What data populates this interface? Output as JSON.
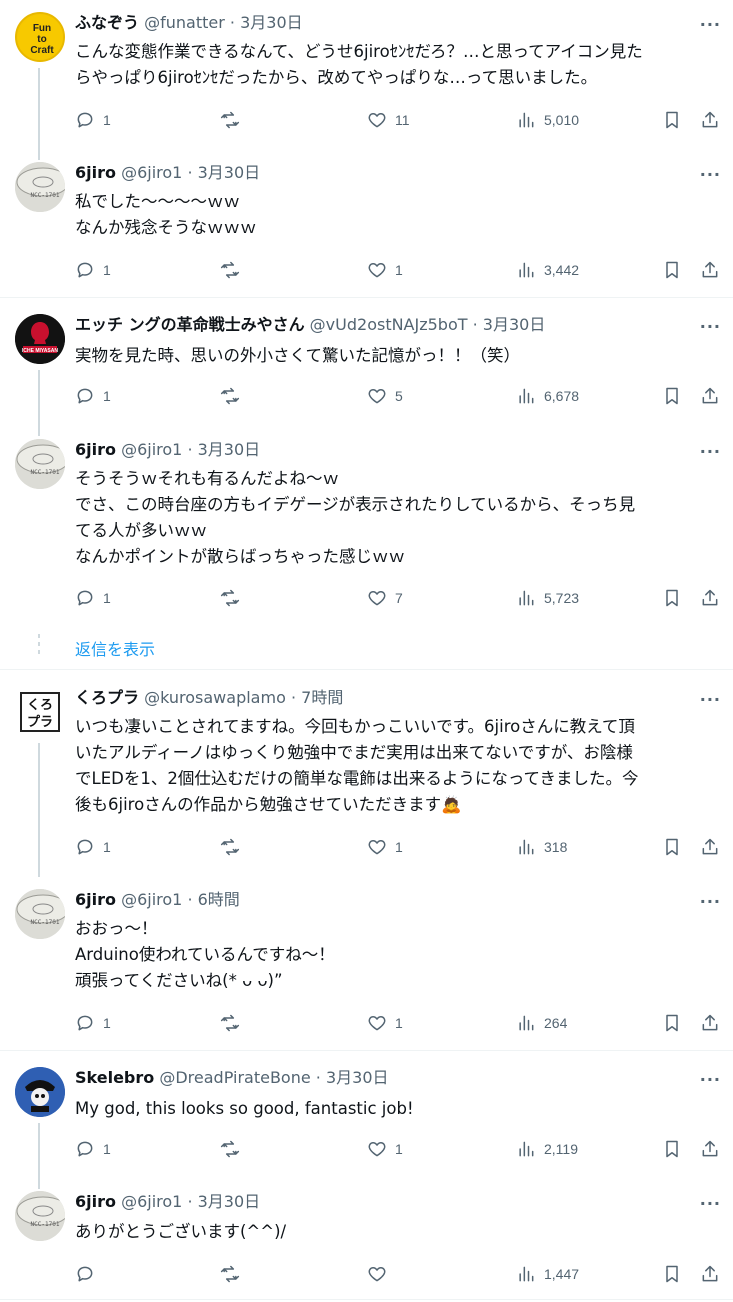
{
  "tweets": [
    {
      "name": "ふなぞう",
      "handle": "@funatter",
      "date": "3月30日",
      "lines": [
        "こんな変態作業できるなんて、どうせ6jiroｾﾝｾだろ？…と思ってアイコン見た",
        "らやっぱり6jiroｾﾝｾだったから、改めてやっぱりな…って思いました。"
      ],
      "replies": "1",
      "retweets": "",
      "likes": "11",
      "views": "5,010",
      "avatar": "fun-to-craft"
    },
    {
      "name": "6jiro",
      "handle": "@6jiro1",
      "date": "3月30日",
      "lines": [
        "私でした～～～～ｗｗ",
        "なんか残念そうなｗｗｗ"
      ],
      "replies": "1",
      "retweets": "",
      "likes": "1",
      "views": "3,442",
      "avatar": "6jiro"
    },
    {
      "name": "エッチ ングの革命戦士みやさん",
      "handle": "@vUd2ostNAJz5boT",
      "date": "3月30日",
      "lines": [
        "実物を見た時、思いの外小さくて驚いた記憶がっ！！（笑）"
      ],
      "replies": "1",
      "retweets": "",
      "likes": "5",
      "views": "6,678",
      "avatar": "miyasan"
    },
    {
      "name": "6jiro",
      "handle": "@6jiro1",
      "date": "3月30日",
      "lines": [
        "そうそうｗそれも有るんだよね～ｗ",
        "でさ、この時台座の方もイデゲージが表示されたりしているから、そっち見",
        "てる人が多いｗｗ",
        "なんかポイントが散らばっちゃった感じｗｗ"
      ],
      "replies": "1",
      "retweets": "",
      "likes": "7",
      "views": "5,723",
      "avatar": "6jiro"
    },
    {
      "name": "くろプラ",
      "handle": "@kurosawaplamo",
      "date": "7時間",
      "lines": [
        "いつも凄いことされてますね。今回もかっこいいです。6jiroさんに教えて頂",
        "いたアルディーノはゆっくり勉強中でまだ実用は出来てないですが、お陰様",
        "でLEDを1、2個仕込むだけの簡単な電飾は出来るようになってきました。今",
        "後も6jiroさんの作品から勉強させていただきます🙇"
      ],
      "replies": "1",
      "retweets": "",
      "likes": "1",
      "views": "318",
      "avatar": "kuropura"
    },
    {
      "name": "6jiro",
      "handle": "@6jiro1",
      "date": "6時間",
      "lines": [
        "おおっ～！",
        "Arduino使われているんですね～！",
        "頑張ってくださいね(* ᴗ ᴗ)”"
      ],
      "replies": "1",
      "retweets": "",
      "likes": "1",
      "views": "264",
      "avatar": "6jiro"
    },
    {
      "name": "Skelebro",
      "handle": "@DreadPirateBone",
      "date": "3月30日",
      "lines": [
        "My god, this looks so good, fantastic job!"
      ],
      "replies": "1",
      "retweets": "",
      "likes": "1",
      "views": "2,119",
      "avatar": "skelebro"
    },
    {
      "name": "6jiro",
      "handle": "@6jiro1",
      "date": "3月30日",
      "lines": [
        "ありがとうございます(^^)/"
      ],
      "replies": "",
      "retweets": "",
      "likes": "",
      "views": "1,447",
      "avatar": "6jiro"
    }
  ],
  "show_replies_label": "返信を表示",
  "separator_dot": "·",
  "more_label": "···",
  "avatar_text": {
    "fun_to_craft": [
      "Fun",
      "to",
      "Craft"
    ],
    "miyasan": "ICHE MIYASAN",
    "kuropura": [
      "くろ",
      "プラ"
    ],
    "sixjiro_ring": "NCC-1701"
  },
  "colors": {
    "accent": "#1d9bf0",
    "secondary_text": "#536471",
    "thread_line": "#cfd9de",
    "divider": "#eff3f4"
  }
}
